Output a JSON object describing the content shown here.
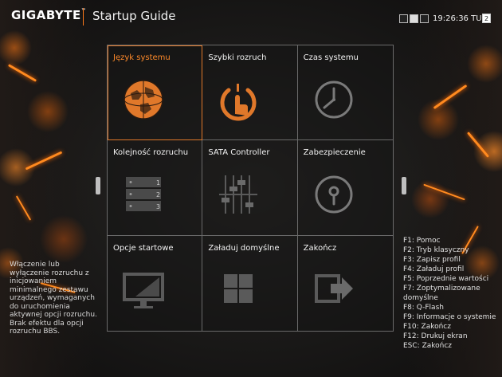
{
  "header": {
    "brand": "GIGABYTE",
    "brand_tm": "™",
    "title": "Startup Guide",
    "time": "19:26:36 TUE",
    "day_badge": "2"
  },
  "tiles": [
    {
      "label": "Język systemu",
      "icon": "globe-icon",
      "active": true
    },
    {
      "label": "Szybki rozruch",
      "icon": "power-touch-icon",
      "active": false
    },
    {
      "label": "Czas systemu",
      "icon": "clock-icon",
      "active": false
    },
    {
      "label": "Kolejność rozruchu",
      "icon": "drive-order-icon",
      "active": false
    },
    {
      "label": "SATA Controller",
      "icon": "sliders-icon",
      "active": false
    },
    {
      "label": "Zabezpieczenie",
      "icon": "lock-icon",
      "active": false
    },
    {
      "label": "Opcje startowe",
      "icon": "monitor-icon",
      "active": false
    },
    {
      "label": "Załaduj domyślne",
      "icon": "windows-grid-icon",
      "active": false
    },
    {
      "label": "Zakończ",
      "icon": "exit-icon",
      "active": false
    }
  ],
  "drive_numbers": [
    "1",
    "2",
    "3"
  ],
  "help_text": "Włączenie lub wyłączenie rozruchu z inicjowaniem minimalnego zestawu urządzeń, wymaganych do uruchomienia aktywnej opcji rozruchu. Brak efektu dla opcji rozruchu BBS.",
  "help_lines": [
    "Włączenie lub",
    "wyłączenie rozruchu z",
    "inicjowaniem",
    "minimalnego zestawu",
    "urządzeń, wymaganych",
    "do uruchomienia",
    "aktywnej opcji rozruchu.",
    "Brak efektu dla opcji",
    "rozruchu BBS."
  ],
  "keys": [
    "F1: Pomoc",
    "F2: Tryb klasyczny",
    "F3: Zapisz profil",
    "F4: Załaduj profil",
    "F5: Poprzednie wartości",
    "F7: Zoptymalizowane",
    "domyślne",
    "F8: Q-Flash",
    "F9: Informacje o systemie",
    "F10: Zakończ",
    "F12: Drukuj ekran",
    "ESC: Zakończ"
  ],
  "colors": {
    "accent": "#e0782a",
    "border": "#6a6a6a"
  }
}
